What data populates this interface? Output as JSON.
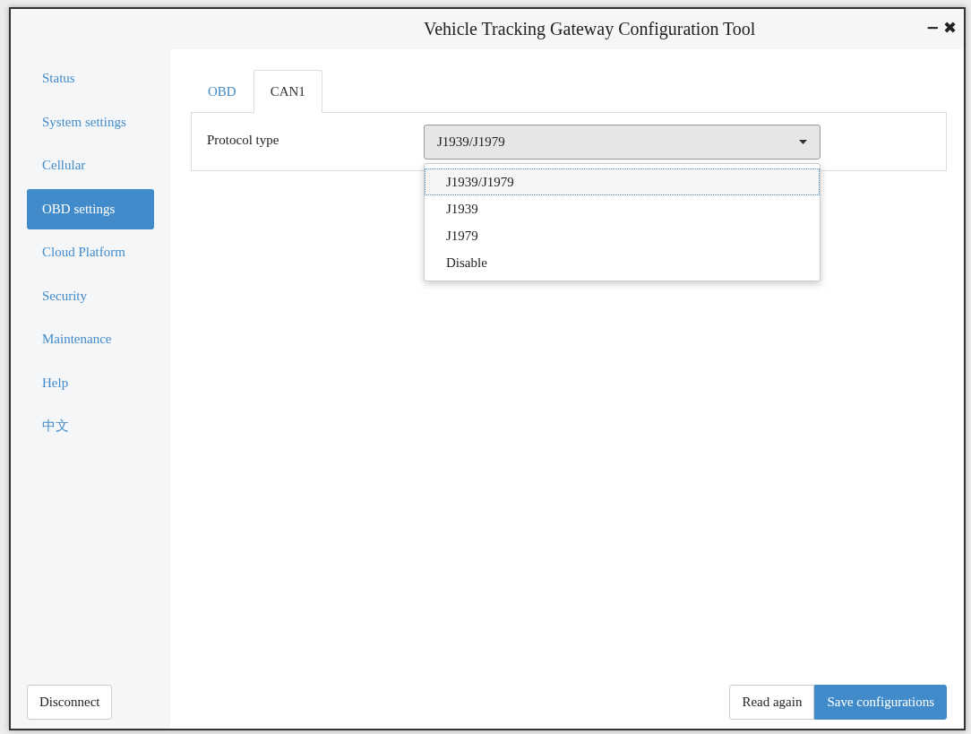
{
  "window": {
    "title": "Vehicle Tracking Gateway Configuration Tool",
    "controls": [
      "−",
      "✖"
    ]
  },
  "sidebar": {
    "items": [
      {
        "label": "Status",
        "selected": false
      },
      {
        "label": "System settings",
        "selected": false
      },
      {
        "label": "Cellular",
        "selected": false
      },
      {
        "label": "OBD settings",
        "selected": true
      },
      {
        "label": "Cloud Platform",
        "selected": false
      },
      {
        "label": "Security",
        "selected": false
      },
      {
        "label": "Maintenance",
        "selected": false
      },
      {
        "label": "Help",
        "selected": false
      },
      {
        "label": "中文",
        "selected": false
      }
    ],
    "disconnect_button": "Disconnect"
  },
  "tabs": [
    {
      "label": "OBD",
      "selected": false
    },
    {
      "label": "CAN1",
      "selected": true
    }
  ],
  "form": {
    "label": "Protocol type",
    "value": "J1939/J1979",
    "expanded": true,
    "options": [
      {
        "label": "J1939/J1979",
        "selected": true
      },
      {
        "label": "J1939",
        "selected": false
      },
      {
        "label": "J1979",
        "selected": false
      },
      {
        "label": "Disable",
        "selected": false
      }
    ]
  },
  "buttons": [
    {
      "label": "Read again",
      "kind": "secondary"
    },
    {
      "label": "Save configurations",
      "kind": "primary"
    }
  ]
}
